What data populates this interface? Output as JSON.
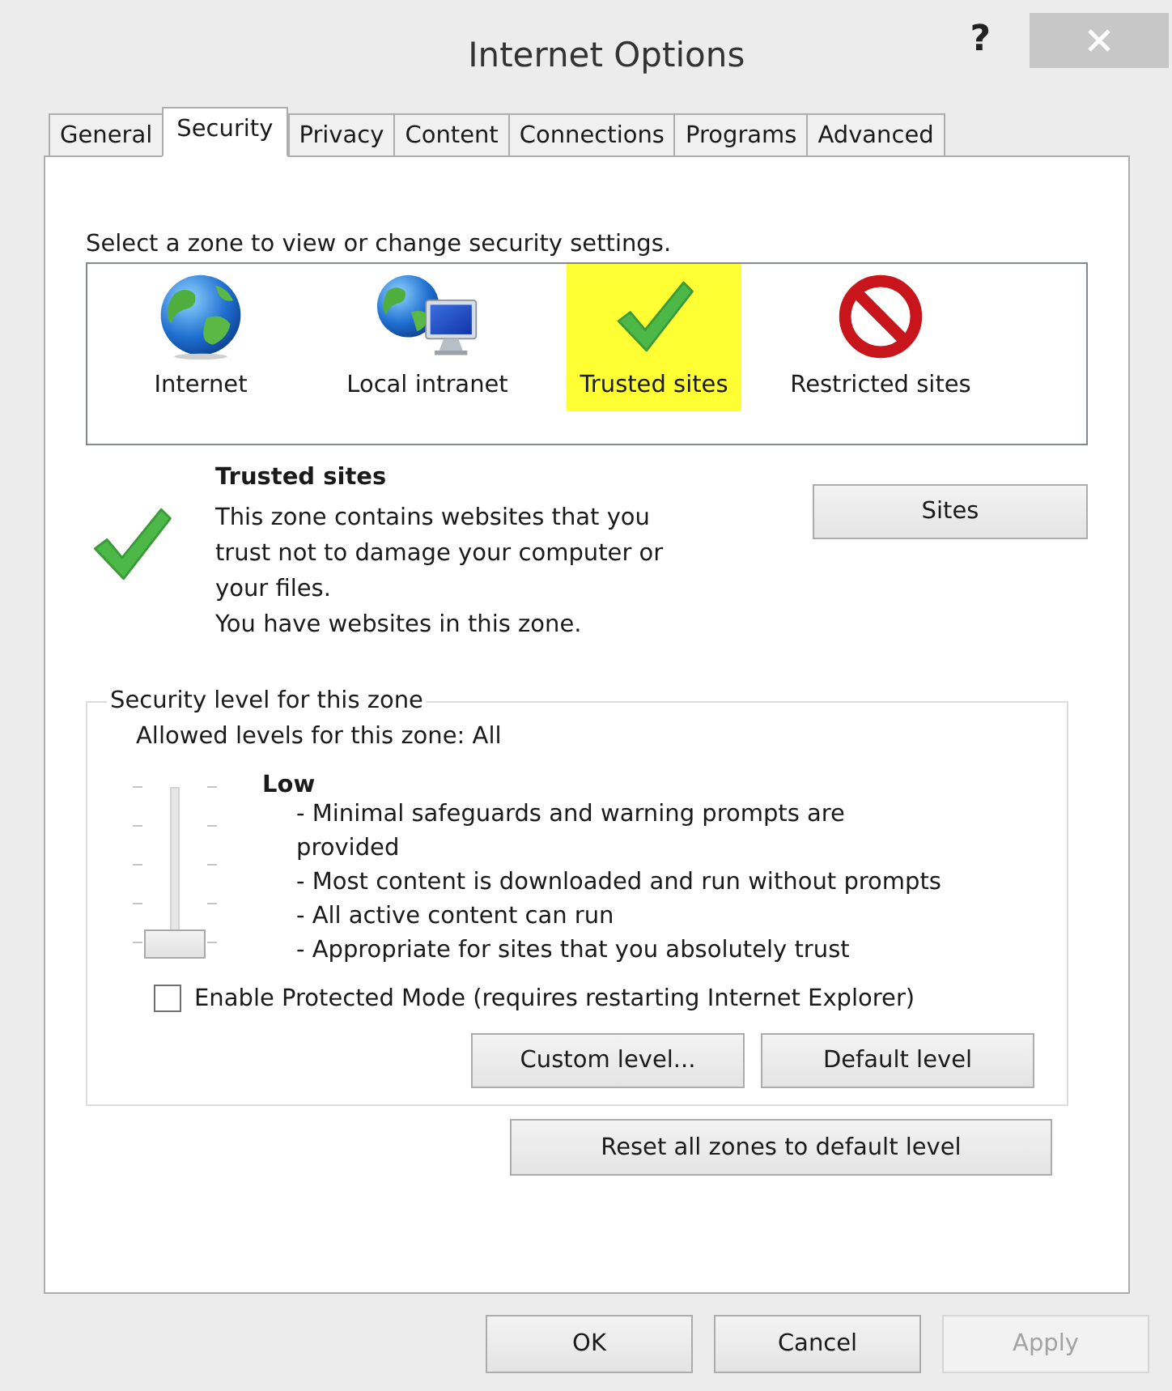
{
  "window": {
    "title": "Internet Options",
    "help": "?"
  },
  "tabs": [
    {
      "label": "General",
      "selected": false
    },
    {
      "label": "Security",
      "selected": true
    },
    {
      "label": "Privacy",
      "selected": false
    },
    {
      "label": "Content",
      "selected": false
    },
    {
      "label": "Connections",
      "selected": false
    },
    {
      "label": "Programs",
      "selected": false
    },
    {
      "label": "Advanced",
      "selected": false
    }
  ],
  "zones": {
    "prompt": "Select a zone to view or change security settings.",
    "items": [
      {
        "label": "Internet",
        "kind": "globe",
        "selected": false
      },
      {
        "label": "Local intranet",
        "kind": "intranet",
        "selected": false
      },
      {
        "label": "Trusted sites",
        "kind": "check",
        "selected": true
      },
      {
        "label": "Restricted sites",
        "kind": "forbidden",
        "selected": false
      }
    ]
  },
  "zone_info": {
    "kind": "check",
    "title": "Trusted sites",
    "description": "This zone contains websites that you\ntrust not to damage your computer or\nyour files.\nYou have websites in this zone.",
    "sites_button": "Sites"
  },
  "security_level": {
    "legend": "Security level for this zone",
    "allowed": "Allowed levels for this zone: All",
    "level": 0,
    "level_name": "Low",
    "details": [
      "- Minimal safeguards and warning prompts are\nprovided",
      "- Most content is downloaded and run without prompts",
      "- All active content can run",
      "- Appropriate for sites that you absolutely trust"
    ],
    "protected_mode": {
      "label": "Enable Protected Mode (requires restarting Internet Explorer)",
      "checked": false
    },
    "buttons": [
      {
        "label": "Custom level...",
        "disabled": false
      },
      {
        "label": "Default level",
        "disabled": false
      }
    ]
  },
  "reset_button": "Reset all zones to default level",
  "buttons": [
    {
      "label": "OK",
      "disabled": false
    },
    {
      "label": "Cancel",
      "disabled": false
    },
    {
      "label": "Apply",
      "disabled": true
    }
  ]
}
